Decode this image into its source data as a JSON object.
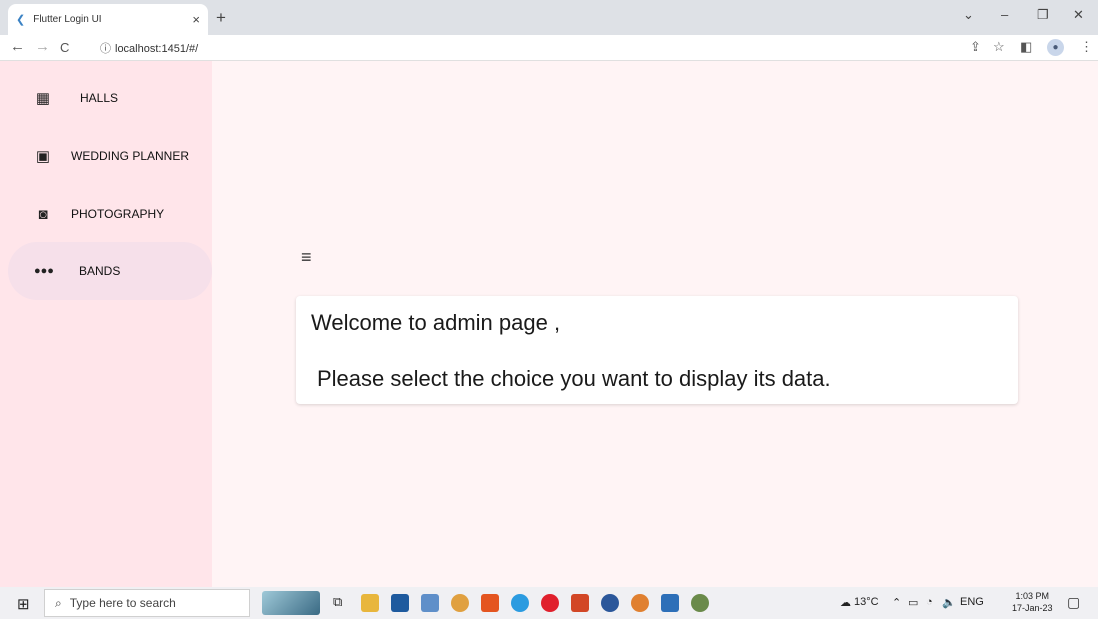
{
  "browser": {
    "tab_title": "Flutter Login UI",
    "favicon": "flutter-icon",
    "tab_close": "×",
    "new_tab": "+",
    "url": "localhost:1451/#/"
  },
  "sidebar": {
    "items": [
      {
        "label": "HALLS",
        "icon": "grid-icon",
        "selected": false
      },
      {
        "label": "WEDDING PLANNER",
        "icon": "calendar-icon",
        "selected": false
      },
      {
        "label": "PHOTOGRAPHY",
        "icon": "camera-icon",
        "selected": false
      },
      {
        "label": "BANDS",
        "icon": "groups-icon",
        "selected": true
      }
    ]
  },
  "main": {
    "welcome": "Welcome to admin page ,",
    "instruction": "Please select the choice you want to display its data."
  },
  "taskbar": {
    "search_placeholder": "Type here to search",
    "weather": "13°C",
    "language": "ENG",
    "time": "1:03 PM",
    "date": "17-Jan-23"
  },
  "colors": {
    "sidebar_bg": "#ffe5ea",
    "selected_bg": "#f6e0ea",
    "main_bg": "#fff4f5",
    "card_bg": "#ffffff"
  }
}
